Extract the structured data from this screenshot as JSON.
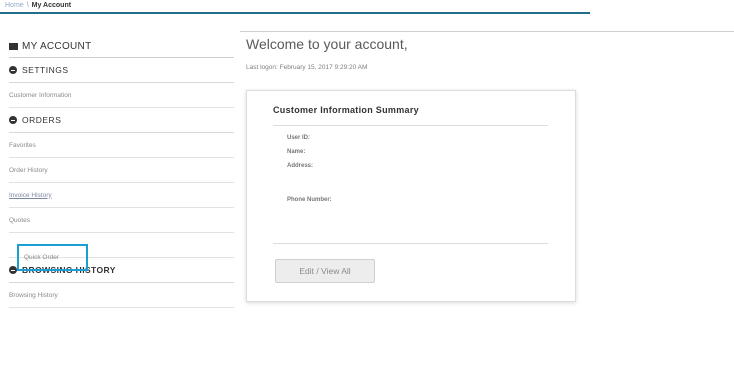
{
  "breadcrumb": {
    "home": "Home",
    "separator": "\\",
    "current": "My Account"
  },
  "sidebar": {
    "title": "MY ACCOUNT",
    "settings": {
      "label": "SETTINGS",
      "items": [
        "Customer Information"
      ]
    },
    "orders": {
      "label": "ORDERS",
      "items": [
        "Favorites",
        "Order History",
        "Invoice History",
        "Quotes",
        "Quick Order"
      ]
    },
    "browsing": {
      "label": "BROWSING HISTORY",
      "items": [
        "Browsing History"
      ]
    }
  },
  "main": {
    "welcome": "Welcome to your account,",
    "last_logon": "Last logon: February 15, 2017 9:29:20 AM",
    "card": {
      "title": "Customer Information Summary",
      "fields": [
        "User ID:",
        "Name:",
        "Address:",
        "Phone Number:"
      ],
      "button": "Edit / View All"
    }
  },
  "colors": {
    "accent_border": "#1a9fd4",
    "top_rule": "#1f6e8c"
  }
}
